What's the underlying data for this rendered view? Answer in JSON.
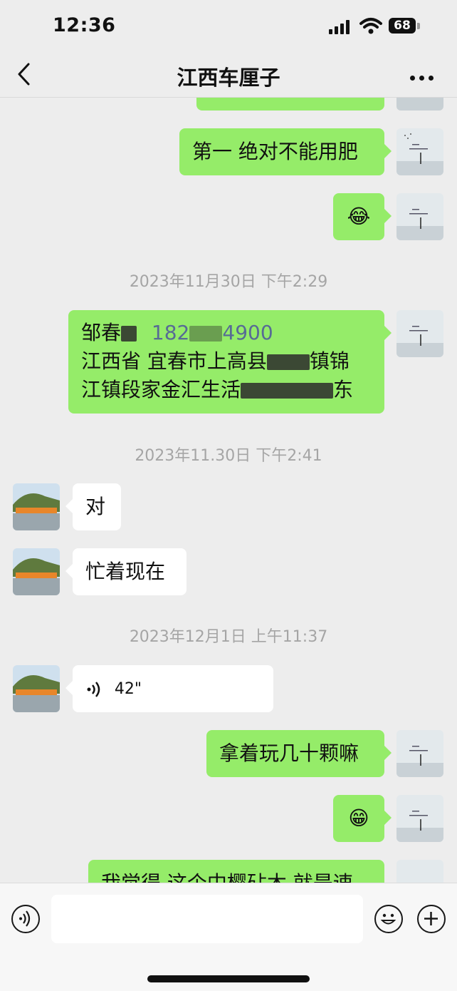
{
  "status_bar": {
    "time": "12:36",
    "battery": "68"
  },
  "nav": {
    "title": "江西车厘子",
    "back_icon": "chevron-left-icon",
    "more_icon": "more-dots-icon"
  },
  "colors": {
    "my_bubble": "#95ec69",
    "other_bubble": "#ffffff",
    "background": "#ededed",
    "timestamp": "#a5a5a5"
  },
  "messages": [
    {
      "from": "me",
      "text": "第一 绝对不能用肥"
    },
    {
      "from": "me",
      "emoji": "😂"
    },
    {
      "timestamp": "2023年11月30日 下午2:29"
    },
    {
      "from": "me",
      "line1_a": "邹春",
      "line1_phone_a": "182",
      "line1_phone_b": "4900",
      "line2_a": "江西省 宜春市上高县",
      "line2_b": "镇锦",
      "line3_a": "江镇段家金汇生活",
      "line3_b": "东"
    },
    {
      "timestamp": "2023年11.30日 下午2:41"
    },
    {
      "from": "other",
      "text": "对"
    },
    {
      "from": "other",
      "text": "忙着现在"
    },
    {
      "timestamp": "2023年12月1日 上午11:37"
    },
    {
      "from": "other",
      "voice": "42\""
    },
    {
      "from": "me",
      "text": "拿着玩几十颗嘛"
    },
    {
      "from": "me",
      "emoji": "😁"
    },
    {
      "from": "me",
      "text": "我觉得 这个中樱砧木 就是速"
    }
  ],
  "composer": {
    "voice_icon": "voice-input-icon",
    "emoji_icon": "emoji-icon",
    "plus_icon": "plus-icon"
  }
}
